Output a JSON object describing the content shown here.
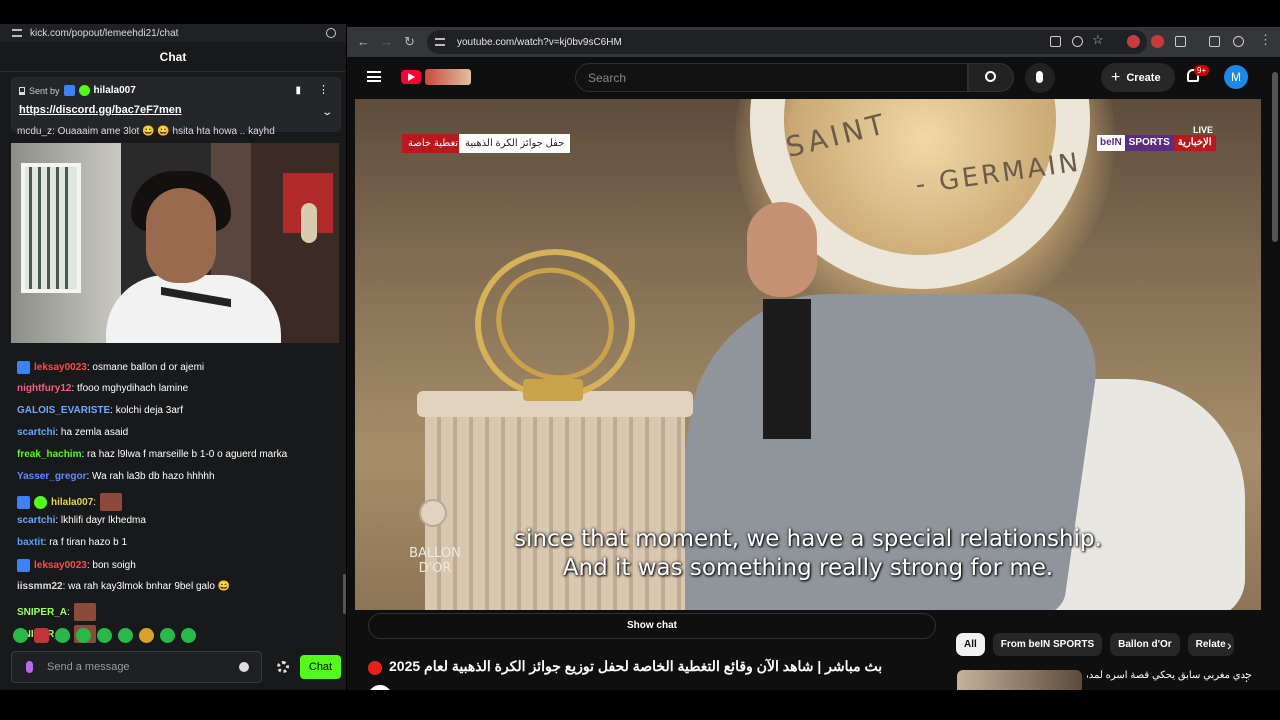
{
  "chat_window": {
    "url": "kick.com/popout/lemeehdi21/chat",
    "title": "Chat",
    "pinned": {
      "sent_by_label": "Sent by",
      "sender": "hilala007",
      "link": "https://discord.gg/bac7eF7men"
    },
    "cut_line": "mcdu_z: Ouaaaim ame 3lot 😀 😀 hsita hta howa .. kayhd",
    "messages": [
      {
        "user": "leksay0023",
        "text": ": osmane ballon d or ajemi",
        "color": "#ff4b4b",
        "badge": true
      },
      {
        "user": "nightfury12",
        "text": ": tfooo mghydihach lamine",
        "color": "#ff5a82",
        "badge": false
      },
      {
        "user": "GALOIS_EVARISTE",
        "text": ": kolchi deja 3arf",
        "color": "#6fa8ff",
        "badge": false
      },
      {
        "user": "scartchi",
        "text": ": ha zemla asaid",
        "color": "#5fa8ff",
        "badge": false
      },
      {
        "user": "freak_hachim",
        "text": ": ra haz l9lwa f marseille b 1-0 o aguerd marka",
        "color": "#53fc18",
        "badge": false
      },
      {
        "user": "Yasser_gregor",
        "text": ": Wa rah la3b db hazo hhhhh",
        "color": "#5a8dff",
        "badge": false
      },
      {
        "user": "hilala007",
        "text": ":",
        "color": "#e8d34a",
        "badge": true,
        "emote": true
      },
      {
        "user": "scartchi",
        "text": ": lkhlifi dayr lkhedma",
        "color": "#5fa8ff",
        "badge": false
      },
      {
        "user": "baxtit",
        "text": ": ra f tiran hazo b 1",
        "color": "#4fa3ff",
        "badge": false
      },
      {
        "user": "leksay0023",
        "text": ": bon soigh",
        "color": "#ff4b4b",
        "badge": true
      },
      {
        "user": "iissmm22",
        "text": ": wa rah kay3lmok bnhar 9bel galo 😄",
        "color": "#dcdcdc",
        "badge": false
      },
      {
        "user": "SNIPER_A",
        "text": ":",
        "color": "#9bff6a",
        "badge": false,
        "emote": true
      },
      {
        "user": "SNIPER_A",
        "text": ":",
        "color": "#9bff6a",
        "badge": false,
        "emote": true
      }
    ],
    "input_placeholder": "Send a message",
    "chat_button": "Chat"
  },
  "browser": {
    "url": "youtube.com/watch?v=kj0bv9sC6HM"
  },
  "youtube": {
    "search_placeholder": "Search",
    "create_label": "Create",
    "notifications": "9+",
    "avatar_letter": "M",
    "player": {
      "tag_red": "تغطية خاصة",
      "tag_white": "حفل جوائز الكرة الذهبية",
      "live": "LIVE",
      "bein_1": "beIN",
      "bein_2": "SPORTS",
      "bein_3": "الإخبارية",
      "crest_1": "SAINT",
      "crest_2": "- GERMAIN",
      "ballon_dor": "BALLON D'OR",
      "subtitle_line_1": "since that moment, we have a special relationship.",
      "subtitle_line_2": "And it was something really strong for me."
    },
    "show_chat": "Show chat",
    "video_title": "بث مباشر | شاهد الآن وقائع التغطية الخاصة لحفل توزيع جوائز الكرة الذهبية لعام 2025",
    "chips": [
      "All",
      "From beIN SPORTS",
      "Ballon d'Or",
      "Relate"
    ],
    "recommended_title": "جدي مغربي سابق يحكي قصة أسره لمدة 17"
  },
  "colors": {
    "kick_green": "#53fc18",
    "yt_red": "#ff0033",
    "live_red": "#e62117"
  }
}
